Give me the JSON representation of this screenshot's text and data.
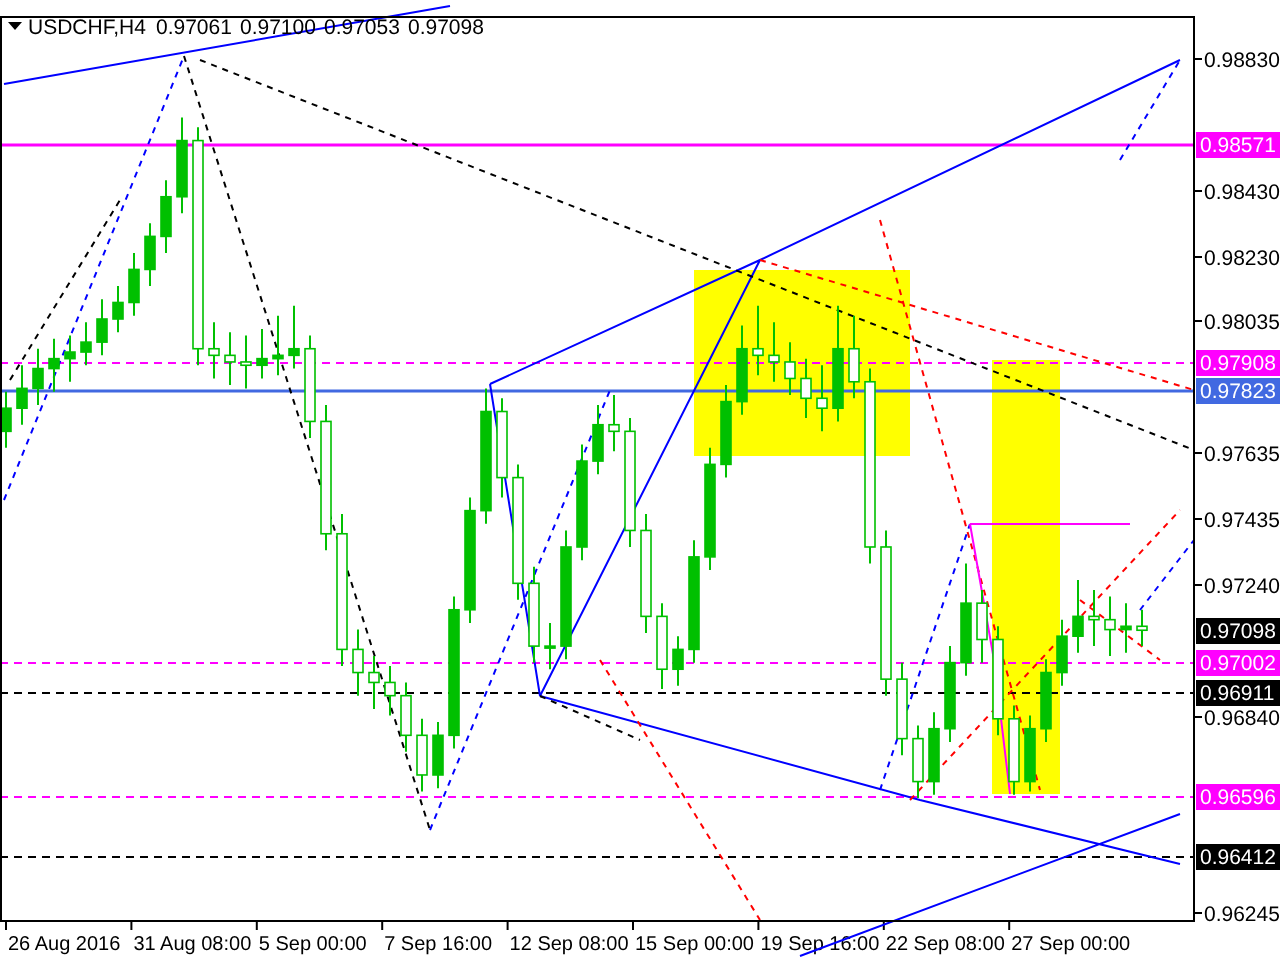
{
  "chart": {
    "symbol": "USDCHF,H4",
    "quotes": [
      "0.97061",
      "0.97100",
      "0.97053",
      "0.97098"
    ],
    "chart_data": {
      "type": "candlestick",
      "ylim": [
        0.96215,
        0.98954
      ],
      "yticks": [
        {
          "value": 0.9883,
          "label": "0.98830"
        },
        {
          "value": 0.9843,
          "label": "0.98430"
        },
        {
          "value": 0.9823,
          "label": "0.98230"
        },
        {
          "value": 0.98035,
          "label": "0.98035"
        },
        {
          "value": 0.97635,
          "label": "0.97635"
        },
        {
          "value": 0.97435,
          "label": "0.97435"
        },
        {
          "value": 0.9724,
          "label": "0.97240"
        },
        {
          "value": 0.9684,
          "label": "0.96840"
        },
        {
          "value": 0.96245,
          "label": "0.96245"
        }
      ],
      "ohlc": [
        [
          0.977,
          0.9782,
          0.9765,
          0.9777
        ],
        [
          0.9777,
          0.979,
          0.9772,
          0.9783
        ],
        [
          0.9783,
          0.9795,
          0.9778,
          0.9789
        ],
        [
          0.9789,
          0.9798,
          0.9782,
          0.9792
        ],
        [
          0.9792,
          0.9799,
          0.9785,
          0.9794
        ],
        [
          0.9794,
          0.9803,
          0.979,
          0.9797
        ],
        [
          0.9797,
          0.981,
          0.9793,
          0.9804
        ],
        [
          0.9804,
          0.9814,
          0.98,
          0.9809
        ],
        [
          0.9809,
          0.9824,
          0.9805,
          0.9819
        ],
        [
          0.9819,
          0.9833,
          0.9814,
          0.9829
        ],
        [
          0.9829,
          0.9846,
          0.9824,
          0.9841
        ],
        [
          0.9841,
          0.9865,
          0.9836,
          0.9858
        ],
        [
          0.9858,
          0.9862,
          0.979,
          0.9795
        ],
        [
          0.9795,
          0.9803,
          0.9786,
          0.9793
        ],
        [
          0.9793,
          0.98,
          0.9784,
          0.9791
        ],
        [
          0.9791,
          0.9799,
          0.9783,
          0.979
        ],
        [
          0.979,
          0.9801,
          0.9786,
          0.9792
        ],
        [
          0.9792,
          0.9805,
          0.9787,
          0.9793
        ],
        [
          0.9793,
          0.9808,
          0.9789,
          0.9795
        ],
        [
          0.9795,
          0.9799,
          0.9768,
          0.9773
        ],
        [
          0.9773,
          0.9778,
          0.9734,
          0.9739
        ],
        [
          0.9739,
          0.9745,
          0.9699,
          0.9704
        ],
        [
          0.9704,
          0.971,
          0.969,
          0.9697
        ],
        [
          0.9697,
          0.9702,
          0.9686,
          0.9694
        ],
        [
          0.9694,
          0.9699,
          0.9684,
          0.969
        ],
        [
          0.969,
          0.9694,
          0.9673,
          0.9678
        ],
        [
          0.9678,
          0.9683,
          0.9661,
          0.9666
        ],
        [
          0.9666,
          0.9682,
          0.9662,
          0.9678
        ],
        [
          0.9678,
          0.972,
          0.9674,
          0.9716
        ],
        [
          0.9716,
          0.975,
          0.9712,
          0.9746
        ],
        [
          0.9746,
          0.9783,
          0.9742,
          0.9776
        ],
        [
          0.9776,
          0.978,
          0.975,
          0.9756
        ],
        [
          0.9756,
          0.976,
          0.9719,
          0.9724
        ],
        [
          0.9724,
          0.9729,
          0.97,
          0.9705
        ],
        [
          0.9705,
          0.9712,
          0.9698,
          0.9705
        ],
        [
          0.9705,
          0.974,
          0.9701,
          0.9735
        ],
        [
          0.9735,
          0.9766,
          0.9731,
          0.9761
        ],
        [
          0.9761,
          0.9778,
          0.9757,
          0.9772
        ],
        [
          0.9772,
          0.9781,
          0.9764,
          0.977
        ],
        [
          0.977,
          0.9774,
          0.9735,
          0.974
        ],
        [
          0.974,
          0.9745,
          0.9709,
          0.9714
        ],
        [
          0.9714,
          0.9718,
          0.9692,
          0.9698
        ],
        [
          0.9698,
          0.9708,
          0.9693,
          0.9704
        ],
        [
          0.9704,
          0.9737,
          0.97,
          0.9732
        ],
        [
          0.9732,
          0.9765,
          0.9728,
          0.976
        ],
        [
          0.976,
          0.9784,
          0.9756,
          0.9779
        ],
        [
          0.9779,
          0.9802,
          0.9775,
          0.9795
        ],
        [
          0.9795,
          0.9808,
          0.9787,
          0.9793
        ],
        [
          0.9793,
          0.9803,
          0.9785,
          0.9791
        ],
        [
          0.9791,
          0.9797,
          0.9781,
          0.9786
        ],
        [
          0.9786,
          0.9792,
          0.9774,
          0.978
        ],
        [
          0.978,
          0.979,
          0.977,
          0.9777
        ],
        [
          0.9777,
          0.9808,
          0.9773,
          0.9795
        ],
        [
          0.9795,
          0.9805,
          0.978,
          0.9785
        ],
        [
          0.9785,
          0.9789,
          0.973,
          0.9735
        ],
        [
          0.9735,
          0.974,
          0.969,
          0.9695
        ],
        [
          0.9695,
          0.97,
          0.9672,
          0.9677
        ],
        [
          0.9677,
          0.9681,
          0.9659,
          0.9664
        ],
        [
          0.9664,
          0.9685,
          0.966,
          0.968
        ],
        [
          0.968,
          0.9705,
          0.9676,
          0.97
        ],
        [
          0.97,
          0.973,
          0.9696,
          0.9718
        ],
        [
          0.9718,
          0.9722,
          0.97,
          0.9707
        ],
        [
          0.9707,
          0.9711,
          0.9678,
          0.9683
        ],
        [
          0.9683,
          0.9687,
          0.966,
          0.9664
        ],
        [
          0.9664,
          0.9684,
          0.9661,
          0.968
        ],
        [
          0.968,
          0.9701,
          0.9676,
          0.9697
        ],
        [
          0.9697,
          0.9713,
          0.9693,
          0.9708
        ],
        [
          0.9708,
          0.9725,
          0.9703,
          0.9714
        ],
        [
          0.9714,
          0.9722,
          0.9705,
          0.9713
        ],
        [
          0.9713,
          0.972,
          0.9702,
          0.971
        ],
        [
          0.971,
          0.9718,
          0.9703,
          0.9711
        ],
        [
          0.9711,
          0.9716,
          0.9705,
          0.97098
        ]
      ]
    },
    "time_labels": [
      "26 Aug 2016",
      "31 Aug 08:00",
      "5 Sep 00:00",
      "7 Sep 16:00",
      "12 Sep 08:00",
      "15 Sep 00:00",
      "19 Sep 16:00",
      "22 Sep 08:00",
      "27 Sep 00:00"
    ],
    "price_levels": [
      {
        "text": "0.98571",
        "color": "#ff00ff",
        "kind": "solid"
      },
      {
        "text": "0.97908",
        "color": "#ff00ff",
        "kind": "dashed"
      },
      {
        "text": "0.97823",
        "color": "#4169e1",
        "kind": "solid"
      },
      {
        "text": "0.97098",
        "color": "#000000",
        "kind": "none"
      },
      {
        "text": "0.97002",
        "color": "#ff00ff",
        "kind": "dashed"
      },
      {
        "text": "0.96911",
        "color": "#000000",
        "kind": "dashed"
      },
      {
        "text": "0.96596",
        "color": "#ff00ff",
        "kind": "dashed"
      },
      {
        "text": "0.96412",
        "color": "#000000",
        "kind": "dashed"
      }
    ]
  }
}
